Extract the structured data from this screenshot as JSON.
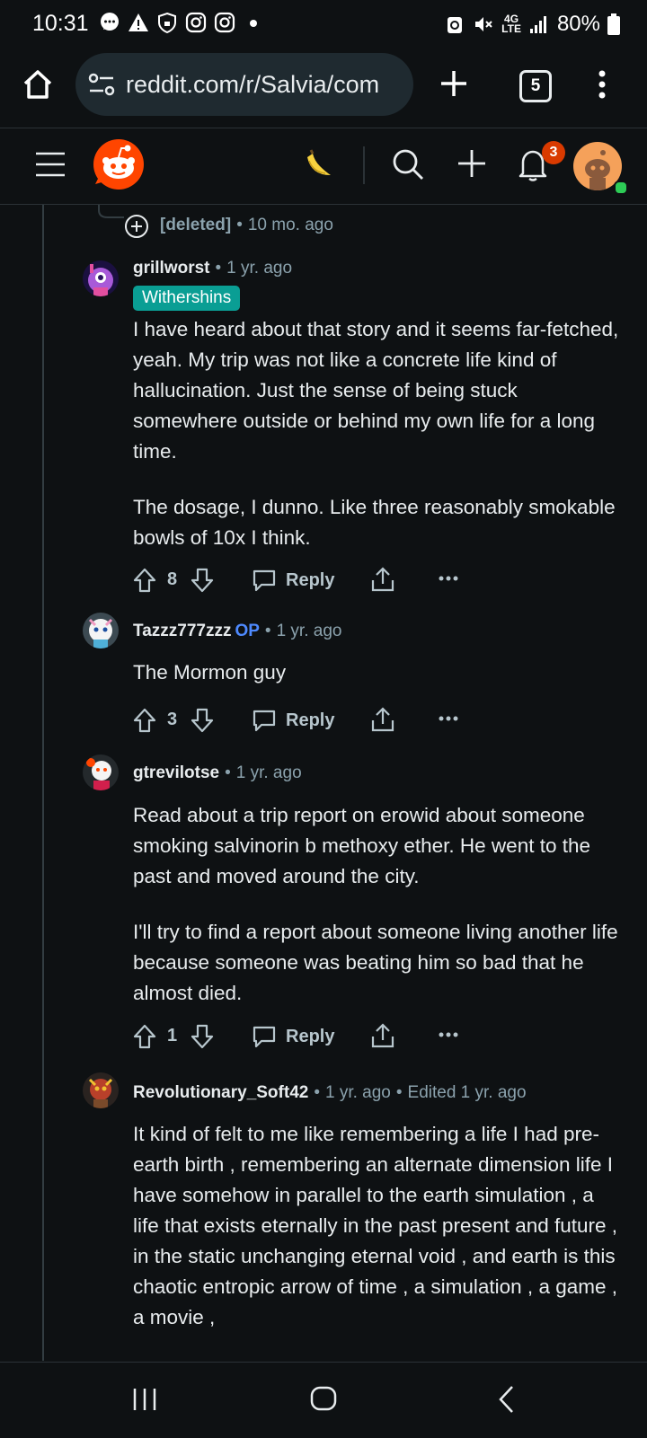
{
  "status_bar": {
    "time": "10:31",
    "network": "4G LTE",
    "battery": "80%"
  },
  "browser": {
    "url": "reddit.com/r/Salvia/com",
    "tab_count": "5"
  },
  "header": {
    "notification_count": "3"
  },
  "collapsed": {
    "author": "[deleted]",
    "age": "10 mo. ago"
  },
  "comments": [
    {
      "author": "grillworst",
      "age": "1 yr. ago",
      "flair": "Withershins",
      "paragraphs": [
        "I have heard about that story and it seems far-fetched, yeah. My trip was not like a concrete life kind of hallucination. Just the sense of being stuck somewhere outside or behind my own life for a long time.",
        "The dosage, I dunno. Like three reasonably smokable bowls of 10x I think."
      ],
      "score": "8",
      "reply": "Reply"
    },
    {
      "author": "Tazzz777zzz",
      "op": "OP",
      "age": "1 yr. ago",
      "paragraphs": [
        "The Mormon guy"
      ],
      "score": "3",
      "reply": "Reply"
    },
    {
      "author": "gtrevilotse",
      "age": "1 yr. ago",
      "paragraphs": [
        "Read about a trip report on erowid about someone smoking salvinorin b methoxy ether. He went to the past and moved around the city.",
        "I'll try to find a report about someone living another life because someone was beating him so bad that he almost died."
      ],
      "score": "1",
      "reply": "Reply"
    },
    {
      "author": "Revolutionary_Soft42",
      "age": "1 yr. ago",
      "edited": "Edited 1 yr. ago",
      "paragraphs": [
        "It kind of felt to me like remembering a life I had pre-earth birth , remembering an alternate dimension life I have somehow in parallel to the earth simulation , a life that exists eternally in the past present and future , in the static unchanging eternal void , and earth is this chaotic entropic arrow of time , a simulation , a game , a movie ,"
      ]
    }
  ],
  "colors": {
    "background": "#0e1113",
    "flair": "#0a9e94",
    "op": "#4e8aff",
    "badge": "#d93a00",
    "reddit_orange": "#ff4500"
  }
}
